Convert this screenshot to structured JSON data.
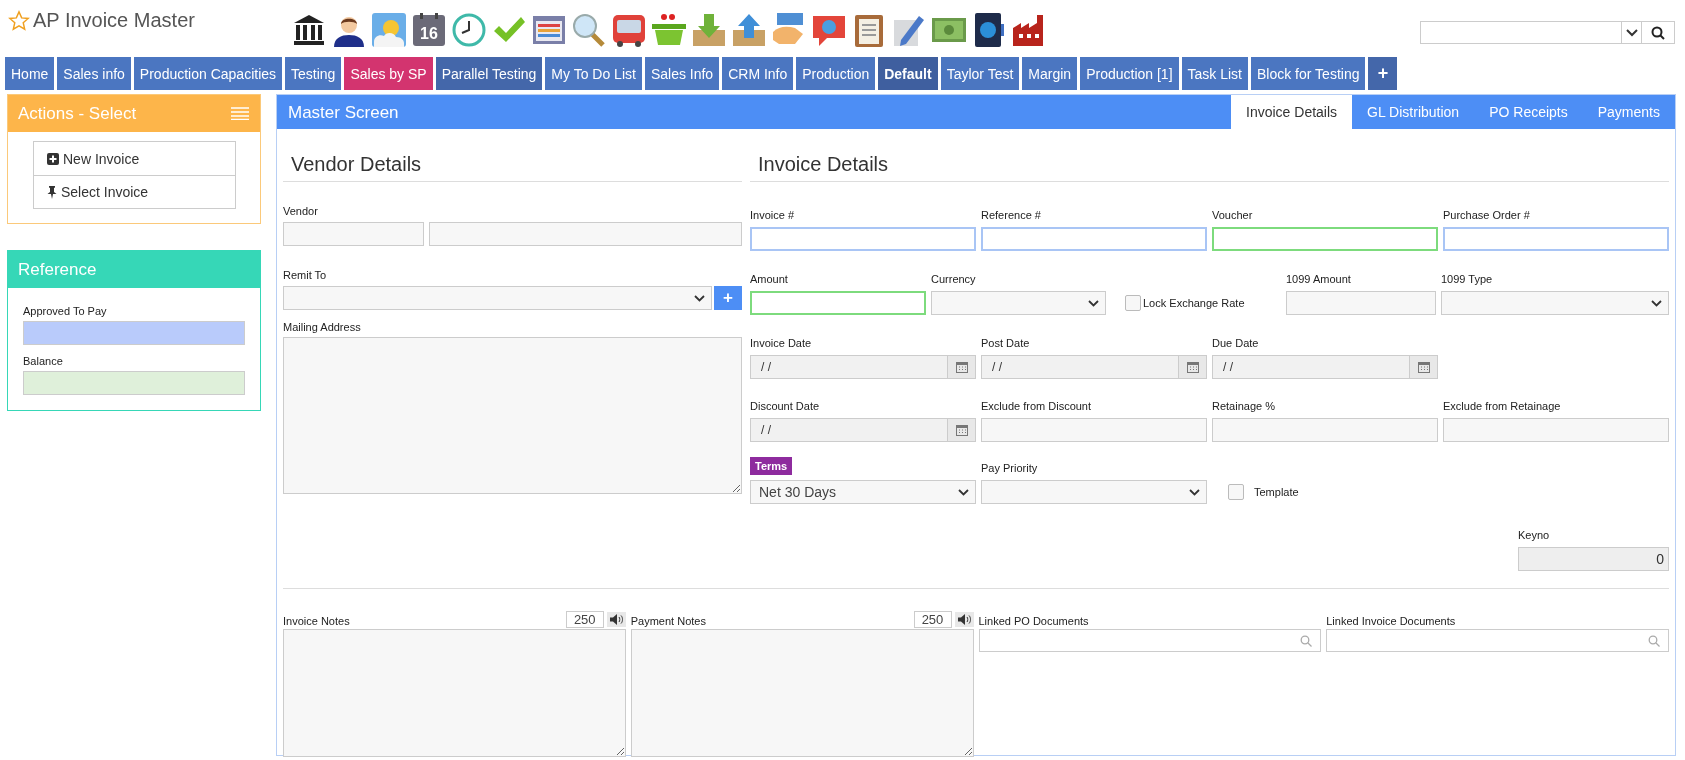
{
  "app": {
    "title": "AP Invoice Master"
  },
  "toolbar": [
    {
      "kind": "bank"
    },
    {
      "kind": "person"
    },
    {
      "kind": "weather"
    },
    {
      "kind": "calendar",
      "label": "16"
    },
    {
      "kind": "clock"
    },
    {
      "kind": "check"
    },
    {
      "kind": "list"
    },
    {
      "kind": "magnifier"
    },
    {
      "kind": "bus"
    },
    {
      "kind": "basket"
    },
    {
      "kind": "download"
    },
    {
      "kind": "upload"
    },
    {
      "kind": "hand"
    },
    {
      "kind": "chat"
    },
    {
      "kind": "clipboard"
    },
    {
      "kind": "pencil"
    },
    {
      "kind": "money"
    },
    {
      "kind": "device"
    },
    {
      "kind": "factory"
    }
  ],
  "nav_tabs": [
    {
      "label": "Home",
      "selected": false,
      "color": "#4b76c1"
    },
    {
      "label": "Sales info",
      "selected": false,
      "color": "#4b76c1"
    },
    {
      "label": "Production Capacities",
      "selected": false,
      "color": "#4b76c1"
    },
    {
      "label": "Testing",
      "selected": false,
      "color": "#4b76c1"
    },
    {
      "label": "Sales by SP",
      "selected": false,
      "color": "#d3346f"
    },
    {
      "label": "Parallel Testing",
      "selected": false,
      "color": "#4467aa"
    },
    {
      "label": "My To Do List",
      "selected": false,
      "color": "#4b76c1"
    },
    {
      "label": "Sales Info",
      "selected": false,
      "color": "#4b76c1"
    },
    {
      "label": "CRM Info",
      "selected": false,
      "color": "#4b76c1"
    },
    {
      "label": "Production",
      "selected": false,
      "color": "#4b76c1"
    },
    {
      "label": "Default",
      "selected": true,
      "color": "#3f5f9f"
    },
    {
      "label": "Taylor Test",
      "selected": false,
      "color": "#4b76c1"
    },
    {
      "label": "Margin",
      "selected": false,
      "color": "#4b76c1"
    },
    {
      "label": "Production [1]",
      "selected": false,
      "color": "#4b76c1"
    },
    {
      "label": "Task List",
      "selected": false,
      "color": "#4b76c1"
    },
    {
      "label": "Block for Testing",
      "selected": false,
      "color": "#4b76c1"
    }
  ],
  "add_tab": {
    "label": "+"
  },
  "actions_panel": {
    "title": "Actions - Select",
    "items": [
      {
        "label": "New Invoice",
        "kind": "new"
      },
      {
        "label": "Select Invoice",
        "kind": "select"
      }
    ]
  },
  "reference_panel": {
    "title": "Reference",
    "fields": [
      {
        "label": "Approved To Pay",
        "color": "#b9cbfb"
      },
      {
        "label": "Balance",
        "color": "#dff0da"
      }
    ]
  },
  "master": {
    "title": "Master Screen",
    "tabs": [
      {
        "label": "Invoice Details",
        "selected": true
      },
      {
        "label": "GL Distribution",
        "selected": false
      },
      {
        "label": "PO Receipts",
        "selected": false
      },
      {
        "label": "Payments",
        "selected": false
      }
    ]
  },
  "vendor_section": {
    "heading": "Vendor Details",
    "vendor_label": "Vendor",
    "remit_to_label": "Remit To",
    "remit_add": "+",
    "mailing_address_label": "Mailing Address"
  },
  "invoice_section": {
    "heading": "Invoice Details",
    "rows": [
      [
        {
          "label": "Invoice #",
          "kind": "text",
          "color": "#a9c5f5"
        },
        {
          "label": "Reference #",
          "kind": "text",
          "color": "#a9c5f5"
        },
        {
          "label": "Voucher",
          "kind": "text",
          "color": "#7ddb7d"
        },
        {
          "label": "Purchase Order #",
          "kind": "text",
          "color": "#a9c5f5"
        }
      ],
      [
        {
          "label": "Amount",
          "kind": "text",
          "color": "#7ddb7d"
        },
        {
          "label": "Currency",
          "kind": "select"
        },
        {
          "label": "Lock Exchange Rate",
          "kind": "checkbox",
          "checked": false
        },
        {
          "label": "1099 Amount",
          "kind": "text"
        },
        {
          "label": "1099 Type",
          "kind": "select"
        }
      ],
      [
        {
          "label": "Invoice Date",
          "kind": "date",
          "value": "/  /"
        },
        {
          "label": "Post Date",
          "kind": "date",
          "value": "/  /"
        },
        {
          "label": "Due Date",
          "kind": "date",
          "value": "/  /"
        }
      ],
      [
        {
          "label": "Discount Date",
          "kind": "date",
          "value": "/  /"
        },
        {
          "label": "Exclude from Discount",
          "kind": "text"
        },
        {
          "label": "Retainage %",
          "kind": "text"
        },
        {
          "label": "Exclude from Retainage",
          "kind": "text"
        }
      ],
      [
        {
          "label": "Terms",
          "kind": "select",
          "value": "Net 30 Days",
          "tagged": true
        },
        {
          "label": "Pay Priority",
          "kind": "select"
        },
        {
          "label": "Template",
          "kind": "checkbox",
          "checked": false
        }
      ]
    ],
    "keyno": {
      "label": "Keyno",
      "value": "0"
    }
  },
  "notes": [
    {
      "label": "Invoice Notes",
      "count": "250"
    },
    {
      "label": "Payment Notes",
      "count": "250"
    }
  ],
  "linked_documents": [
    {
      "label": "Linked PO Documents"
    },
    {
      "label": "Linked Invoice Documents"
    }
  ]
}
